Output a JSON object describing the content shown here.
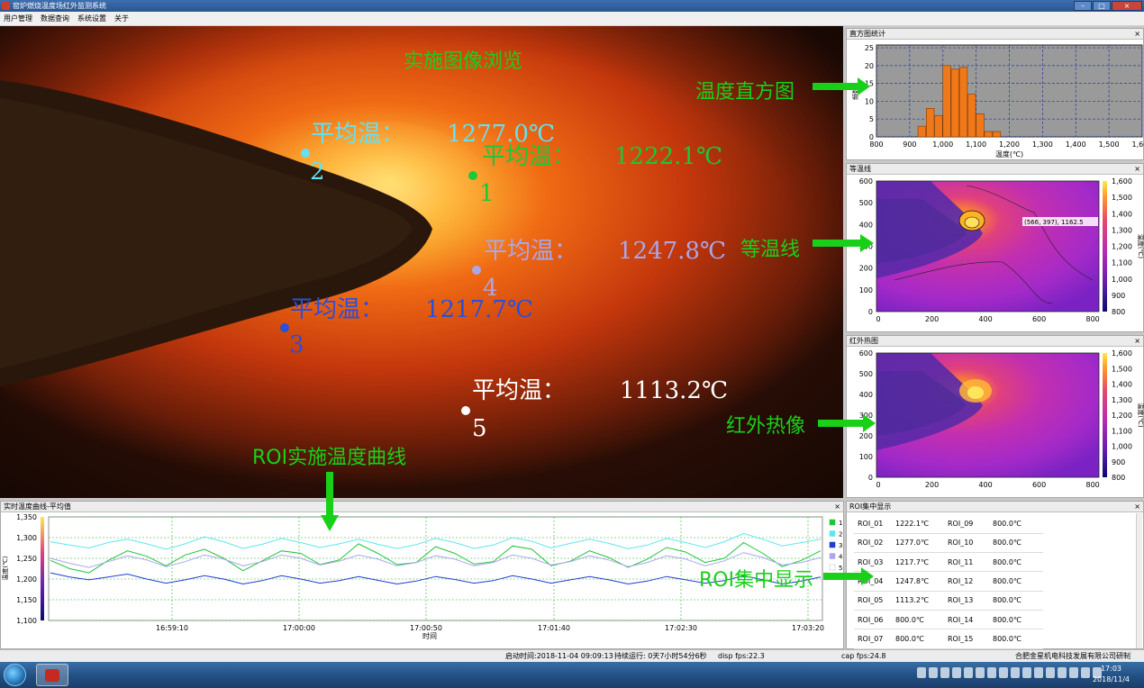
{
  "window": {
    "title": "窑炉燃烧温度场红外监测系统"
  },
  "menu": [
    "用户管理",
    "数据查询",
    "系统设置",
    "关于"
  ],
  "video": {
    "title": "实施图像浏览",
    "rois": [
      {
        "num": "2",
        "label": "平均温：",
        "value": "1277.0℃",
        "color": "#64e0f0"
      },
      {
        "num": "1",
        "label": "平均温：",
        "value": "1222.1℃",
        "color": "#19c93a"
      },
      {
        "num": "4",
        "label": "平均温：",
        "value": "1247.8℃",
        "color": "#a9a7e8"
      },
      {
        "num": "3",
        "label": "平均温：",
        "value": "1217.7℃",
        "color": "#2a4fd8"
      },
      {
        "num": "5",
        "label": "平均温：",
        "value": "1113.2℃",
        "color": "#ffffff"
      }
    ]
  },
  "histogram": {
    "title": "直方图统计",
    "xlabel": "温度(℃)",
    "ylabel": "频数",
    "x_ticks": [
      "800",
      "900",
      "1,000",
      "1,100",
      "1,200",
      "1,300",
      "1,400",
      "1,500",
      "1,600"
    ],
    "y_ticks": [
      "0",
      "5",
      "10",
      "15",
      "20",
      "25"
    ]
  },
  "isotherm": {
    "title": "等温线",
    "readout": "(566, 397), 1162.5",
    "x_ticks": [
      "0",
      "200",
      "400",
      "600",
      "800"
    ],
    "y_ticks": [
      "0",
      "100",
      "200",
      "300",
      "400",
      "500",
      "600"
    ],
    "scale_ticks": [
      "800",
      "900",
      "1,000",
      "1,100",
      "1,200",
      "1,300",
      "1,400",
      "1,500",
      "1,600"
    ],
    "scale_label": "温度(℃)"
  },
  "thermal": {
    "title": "红外热图",
    "x_ticks": [
      "0",
      "200",
      "400",
      "600",
      "800"
    ],
    "y_ticks": [
      "0",
      "100",
      "200",
      "300",
      "400",
      "500",
      "600"
    ],
    "scale_ticks": [
      "800",
      "900",
      "1,000",
      "1,100",
      "1,200",
      "1,300",
      "1,400",
      "1,500",
      "1,600"
    ],
    "scale_label": "温度(℃)"
  },
  "curve": {
    "title": "实时温度曲线-平均值",
    "xlabel": "时间",
    "ylabel": "温度(℃)",
    "y_ticks": [
      "1,100",
      "1,150",
      "1,200",
      "1,250",
      "1,300",
      "1,350"
    ],
    "x_ticks": [
      "16:59:10",
      "17:00:00",
      "17:00:50",
      "17:01:40",
      "17:02:30",
      "17:03:20"
    ],
    "legend": [
      {
        "label": "1",
        "color": "#22c33a"
      },
      {
        "label": "2",
        "color": "#5fe6ef"
      },
      {
        "label": "3",
        "color": "#1d3fd1"
      },
      {
        "label": "4",
        "color": "#a8a8ec"
      },
      {
        "label": "5",
        "color": "#ffffff"
      }
    ]
  },
  "chart_data": {
    "type": "line",
    "title": "实时温度曲线-平均值",
    "xlabel": "时间",
    "ylabel": "温度(℃)",
    "ylim": [
      1100,
      1350
    ],
    "x_ticks": [
      "16:59:10",
      "17:00:00",
      "17:00:50",
      "17:01:40",
      "17:02:30",
      "17:03:20"
    ],
    "series": [
      {
        "name": "1",
        "values": [
          1245,
          1225,
          1215,
          1245,
          1268,
          1255,
          1232,
          1258,
          1272,
          1250,
          1220,
          1244,
          1268,
          1262,
          1235,
          1246,
          1285,
          1262,
          1235,
          1240,
          1278,
          1262,
          1236,
          1242,
          1280,
          1272,
          1232,
          1243,
          1268,
          1252,
          1228,
          1248,
          1276,
          1265,
          1240,
          1250,
          1288,
          1262,
          1230,
          1245,
          1268
        ]
      },
      {
        "name": "2",
        "values": [
          1290,
          1282,
          1275,
          1288,
          1296,
          1285,
          1272,
          1285,
          1302,
          1290,
          1274,
          1284,
          1298,
          1288,
          1276,
          1285,
          1296,
          1284,
          1274,
          1283,
          1298,
          1288,
          1274,
          1282,
          1300,
          1291,
          1275,
          1286,
          1296,
          1286,
          1273,
          1282,
          1298,
          1288,
          1276,
          1290,
          1310,
          1296,
          1280,
          1288,
          1296
        ]
      },
      {
        "name": "3",
        "values": [
          1215,
          1205,
          1198,
          1205,
          1212,
          1200,
          1190,
          1198,
          1208,
          1200,
          1188,
          1196,
          1208,
          1200,
          1190,
          1196,
          1206,
          1197,
          1188,
          1195,
          1206,
          1199,
          1190,
          1196,
          1208,
          1200,
          1190,
          1198,
          1206,
          1198,
          1188,
          1195,
          1206,
          1198,
          1190,
          1196,
          1208,
          1198,
          1188,
          1195,
          1205
        ]
      },
      {
        "name": "4",
        "values": [
          1250,
          1238,
          1228,
          1242,
          1256,
          1246,
          1230,
          1242,
          1258,
          1248,
          1232,
          1242,
          1258,
          1250,
          1234,
          1243,
          1258,
          1248,
          1232,
          1240,
          1256,
          1248,
          1232,
          1240,
          1258,
          1250,
          1234,
          1242,
          1256,
          1246,
          1230,
          1240,
          1256,
          1248,
          1232,
          1244,
          1264,
          1252,
          1234,
          1240,
          1252
        ]
      }
    ]
  },
  "roi_panel": {
    "title": "ROI集中显示",
    "left": [
      {
        "name": "ROI_01",
        "value": "1222.1℃"
      },
      {
        "name": "ROI_02",
        "value": "1277.0℃"
      },
      {
        "name": "ROI_03",
        "value": "1217.7℃"
      },
      {
        "name": "ROI_04",
        "value": "1247.8℃"
      },
      {
        "name": "ROI_05",
        "value": "1113.2℃"
      },
      {
        "name": "ROI_06",
        "value": "800.0℃"
      },
      {
        "name": "ROI_07",
        "value": "800.0℃"
      }
    ],
    "right": [
      {
        "name": "ROI_09",
        "value": "800.0℃"
      },
      {
        "name": "ROI_10",
        "value": "800.0℃"
      },
      {
        "name": "ROI_11",
        "value": "800.0℃"
      },
      {
        "name": "ROI_12",
        "value": "800.0℃"
      },
      {
        "name": "ROI_13",
        "value": "800.0℃"
      },
      {
        "name": "ROI_14",
        "value": "800.0℃"
      },
      {
        "name": "ROI_15",
        "value": "800.0℃"
      }
    ]
  },
  "annotations": {
    "histogram": "温度直方图",
    "isotherm": "等温线",
    "thermal": "红外热像",
    "curve": "ROI实施温度曲线",
    "roi": "ROI集中显示"
  },
  "status": {
    "start_time": "启动时间:2018-11-04 09:09:13",
    "run_time": "持续运行: 0天7小时54分6秒",
    "disp_fps": "disp fps:22.3",
    "cap_fps": "cap fps:24.8",
    "company": "合肥金星机电科技发展有限公司研制"
  },
  "taskbar": {
    "time": "17:03",
    "date": "2018/11/4"
  }
}
